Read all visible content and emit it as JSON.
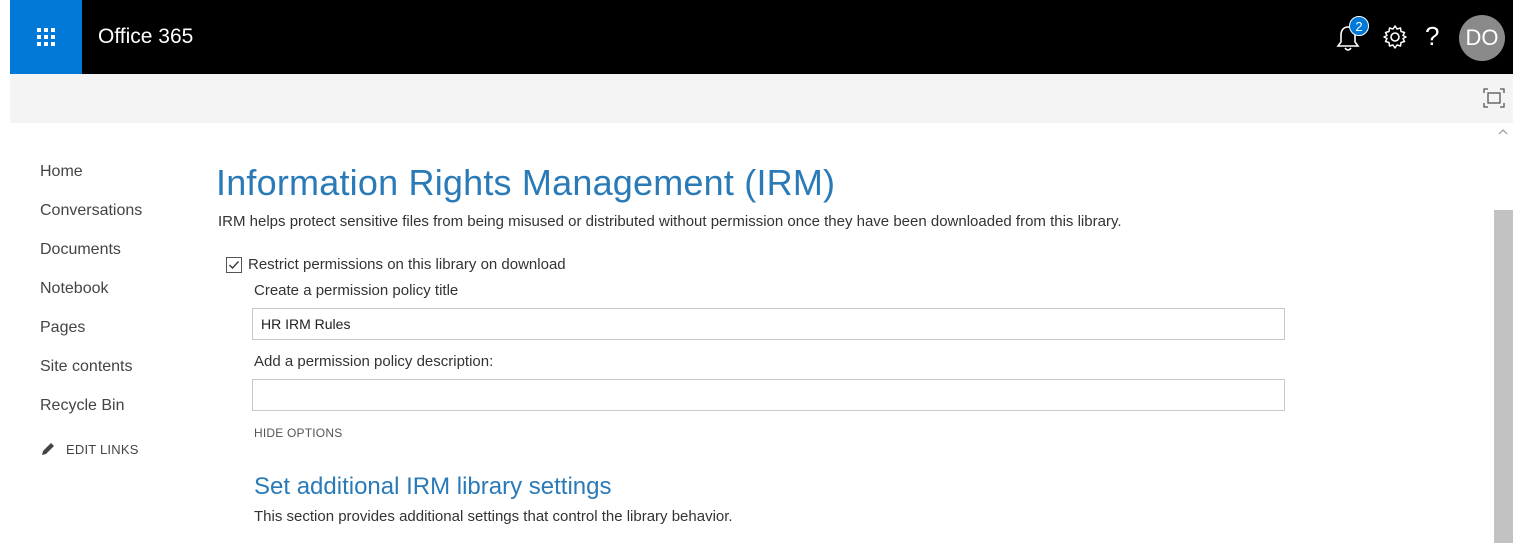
{
  "suitebar": {
    "brand": "Office 365",
    "notifications_count": "2",
    "help_glyph": "?",
    "avatar_initials": "DO",
    "icons": [
      "app-launcher-icon",
      "bell-icon",
      "gear-icon",
      "help-icon"
    ]
  },
  "ribbon": {
    "icons": [
      "focus-mode-icon"
    ]
  },
  "leftnav": {
    "items": [
      {
        "label": "Home"
      },
      {
        "label": "Conversations"
      },
      {
        "label": "Documents"
      },
      {
        "label": "Notebook"
      },
      {
        "label": "Pages"
      },
      {
        "label": "Site contents"
      },
      {
        "label": "Recycle Bin"
      }
    ],
    "edit_links": "EDIT LINKS"
  },
  "main": {
    "title": "Information Rights Management (IRM)",
    "subtitle": "IRM helps protect sensitive files from being misused or distributed without permission once they have been downloaded from this library.",
    "restrict_checkbox": {
      "label": "Restrict permissions on this library on download",
      "checked": true
    },
    "policy_title": {
      "label": "Create a permission policy title",
      "value": "HR IRM Rules"
    },
    "policy_description": {
      "label": "Add a permission policy description:",
      "value": ""
    },
    "hide_options": "HIDE OPTIONS",
    "section": {
      "title": "Set additional IRM library settings",
      "description": "This section provides additional settings that control the library behavior."
    }
  },
  "colors": {
    "suitebar_bg": "#000000",
    "waffle_bg": "#0078d7",
    "title": "#2a7ab8",
    "ribbon_bg": "#f4f4f4"
  }
}
